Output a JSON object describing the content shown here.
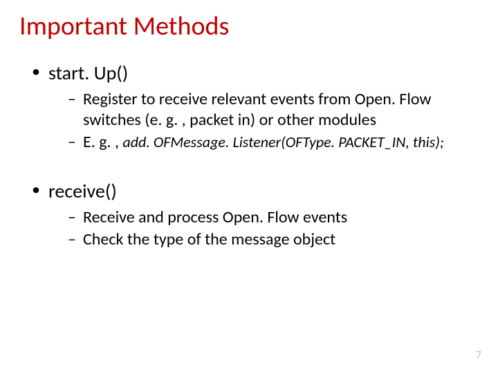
{
  "title": "Important Methods",
  "bullets": [
    {
      "label": "start. Up()",
      "sub": [
        {
          "text": "Register to receive relevant events from Open. Flow switches  (e. g. , packet in) or other modules"
        },
        {
          "prefix": "E. g. , ",
          "code": "add. OFMessage. Listener(OFType. PACKET_IN, this);"
        }
      ]
    },
    {
      "label": "receive()",
      "sub": [
        {
          "text": "Receive and process Open. Flow events"
        },
        {
          "text": "Check the type of the message object"
        }
      ]
    }
  ],
  "page_number": "7"
}
